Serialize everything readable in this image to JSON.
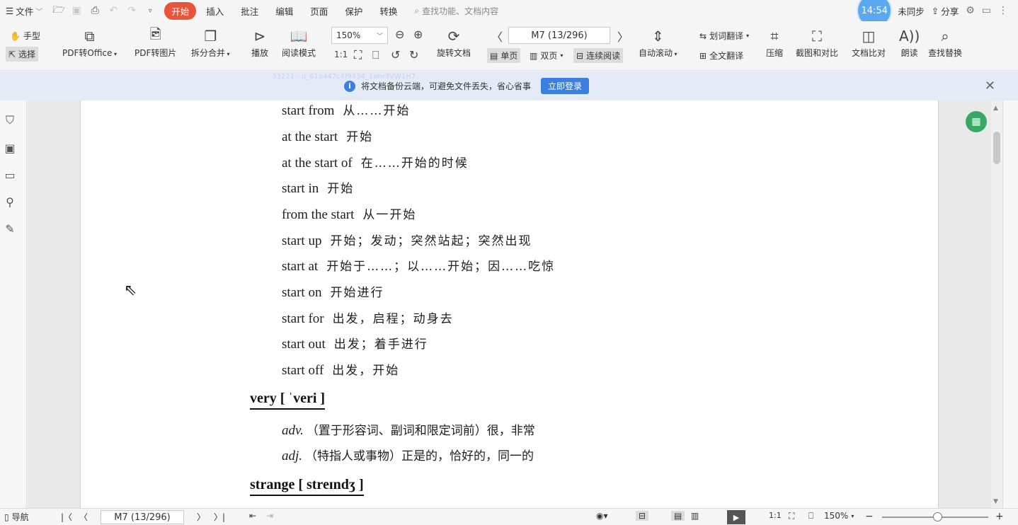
{
  "menubar": {
    "file": "文件",
    "tabs": [
      "开始",
      "插入",
      "批注",
      "编辑",
      "页面",
      "保护",
      "转换"
    ],
    "active_tab": "开始",
    "search_placeholder": "查找功能、文档内容",
    "clock": "14:54",
    "sync": "未同步",
    "share": "分享"
  },
  "toolbar": {
    "hand": "手型",
    "select": "选择",
    "pdf_to_office": "PDF转Office",
    "pdf_to_image": "PDF转图片",
    "split_merge": "拆分合并",
    "play": "播放",
    "read_mode": "阅读模式",
    "zoom": "150%",
    "page": "M7 (13/296)",
    "rotate": "旋转文档",
    "single_page": "单页",
    "double_page": "双页",
    "continuous": "连续阅读",
    "auto_scroll": "自动滚动",
    "word_translate": "划词翻译",
    "full_translate": "全文翻译",
    "compress": "压缩",
    "screenshot_compare": "截图和对比",
    "doc_compare": "文档比对",
    "read_aloud": "朗读",
    "find_replace": "查找替换"
  },
  "notice": {
    "text": "将文档备份云端，可避免文件丢失，省心省事",
    "button": "立即登录",
    "watermark": "33221 - u_61a447c4f9434_1ahr3VW1H7"
  },
  "document": {
    "entries": [
      {
        "en": "start from",
        "zh": "从……开始"
      },
      {
        "en": "at the start",
        "zh": "开始"
      },
      {
        "en": "at the start of",
        "zh": "在……开始的时候"
      },
      {
        "en": "start in",
        "zh": "开始"
      },
      {
        "en": "from the start",
        "zh": "从一开始"
      },
      {
        "en": "start up",
        "zh": "开始；发动；突然站起；突然出现"
      },
      {
        "en": "start at",
        "zh": "开始于……；以……开始；因……吃惊"
      },
      {
        "en": "start on",
        "zh": "开始进行"
      },
      {
        "en": "start for",
        "zh": "出发，启程；动身去"
      },
      {
        "en": "start out",
        "zh": "出发；着手进行"
      },
      {
        "en": "start off",
        "zh": "出发，开始"
      }
    ],
    "very_head": "very [ ˈveri ]",
    "very_defs": [
      {
        "pos": "adv.",
        "zh": "（置于形容词、副词和限定词前）很，非常"
      },
      {
        "pos": "adj.",
        "zh": "（特指人或事物）正是的，恰好的，同一的"
      }
    ],
    "strange_head": "strange [ streɪndʒ ]"
  },
  "status": {
    "nav": "导航",
    "page": "M7 (13/296)",
    "zoom": "150%"
  },
  "colors": {
    "accent": "#e8553d",
    "notice_bg": "#e4ebf6",
    "login_btn": "#3b7fe0"
  }
}
